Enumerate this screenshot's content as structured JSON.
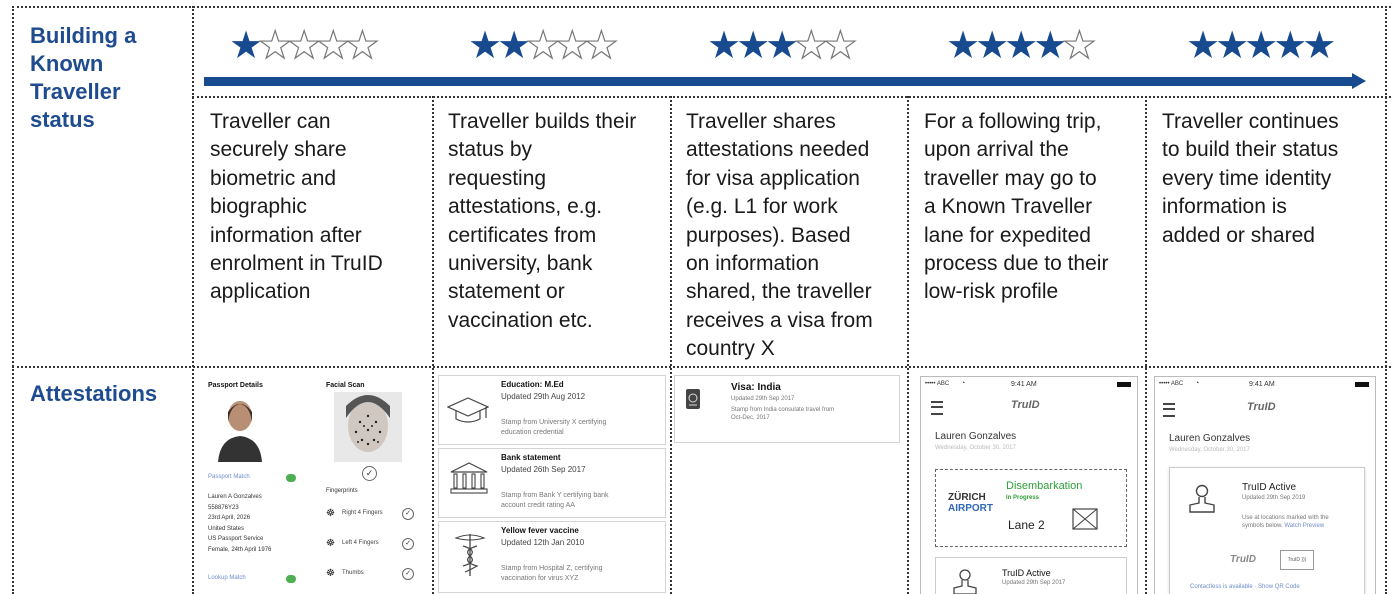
{
  "labels": {
    "status": [
      "Building a",
      "Known",
      "Traveller",
      "status"
    ],
    "attestations": "Attestations"
  },
  "colors": {
    "accent": "#174a8f",
    "label": "#1f4b8f",
    "text": "#1a1a1a"
  },
  "steps": [
    {
      "rating": 1,
      "lines": [
        "Traveller can",
        "securely share",
        "biometric and",
        "biographic",
        "information after",
        "enrolment in TruID",
        "application"
      ]
    },
    {
      "rating": 2,
      "lines": [
        "Traveller builds their",
        "status by",
        "requesting",
        "attestations, e.g.",
        "certificates from",
        "university, bank",
        "statement or",
        "vaccination etc."
      ]
    },
    {
      "rating": 3,
      "lines": [
        "Traveller shares",
        "attestations needed",
        "for visa application",
        "(e.g. L1 for work",
        "purposes). Based",
        "on information",
        "shared, the traveller",
        "receives a visa from",
        "country X"
      ]
    },
    {
      "rating": 4,
      "lines": [
        "For a following trip,",
        "upon arrival the",
        "traveller may go to",
        "a Known Traveller",
        "lane for expedited",
        "process due to their",
        "low-risk profile"
      ]
    },
    {
      "rating": 5,
      "lines": [
        "Traveller continues",
        "to build their status",
        "every time identity",
        "information is",
        "added or shared"
      ]
    }
  ],
  "panel1": {
    "passport_title": "Passport Details",
    "facial_title": "Facial Scan",
    "match_label": "Passport Match",
    "fingerprints_title": "Fingerprints",
    "details": [
      "Lauren A Gonzalves",
      "558876Y23",
      "23rd April, 2026",
      "United States",
      "US Passport Service",
      "Female, 24th April 1976"
    ],
    "fingers": [
      "Right 4 Fingers",
      "Left 4 Fingers",
      "Thumbs"
    ],
    "bottom_match": "Lookup Match"
  },
  "panel2": {
    "items": [
      {
        "title": "Education: M.Ed",
        "updated": "Updated 29th Aug 2012",
        "stamp": [
          "Stamp from University X certifying",
          "education credential"
        ],
        "icon": "graduation-cap-icon"
      },
      {
        "title": "Bank statement",
        "updated": "Updated 26th Sep 2017",
        "stamp": [
          "Stamp from Bank Y certifying bank",
          "account credit rating AA"
        ],
        "icon": "bank-icon"
      },
      {
        "title": "Yellow fever vaccine",
        "updated": "Updated 12th Jan 2010",
        "stamp": [
          "Stamp from Hospital Z, certifying",
          "vaccination for virus XYZ"
        ],
        "icon": "caduceus-icon"
      }
    ]
  },
  "panel3": {
    "title": "Visa: India",
    "updated": "Updated 29th Sep 2017",
    "stamp": [
      "Stamp from India consulate travel from",
      "Oct-Dec, 2017"
    ]
  },
  "panel4": {
    "carrier": "••••• ABC",
    "time": "9:41 AM",
    "brand": "TruID",
    "name": "Lauren Gonzalves",
    "date": "Wednesday, October 30, 2017",
    "airport": [
      "ZÜRICH",
      "AIRPORT"
    ],
    "status": "Disembarkation",
    "progress": "In Progress",
    "lane": "Lane 2",
    "active": "TruID Active",
    "active_updated": "Updated 29th Sep 2017"
  },
  "panel5": {
    "carrier": "••••• ABC",
    "time": "9:41 AM",
    "brand": "TruID",
    "name": "Lauren Gonzalves",
    "date": "Wednesday, October 30, 2017",
    "active": "TruID Active",
    "active_updated": "Updated 29th Sep 2019",
    "note": [
      "Use at locations marked with the",
      "symbols below."
    ],
    "note_link": "Watch Preview",
    "brand2": "TruID",
    "nfc": "TruID",
    "footer": "Contactless is available · Show QR Code"
  }
}
